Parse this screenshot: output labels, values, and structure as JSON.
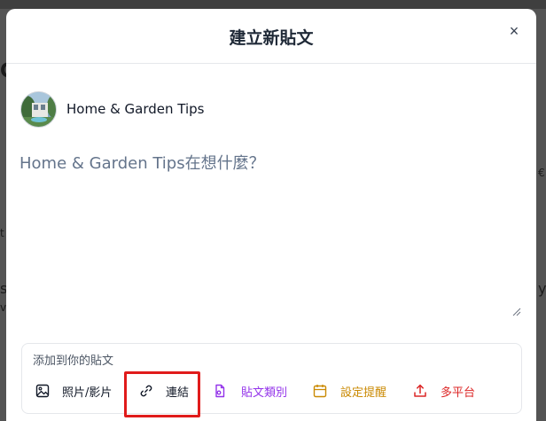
{
  "modal": {
    "title": "建立新貼文",
    "close_label": "×"
  },
  "page": {
    "name": "Home & Garden Tips"
  },
  "composer": {
    "placeholder": "Home & Garden Tips在想什麼？"
  },
  "add_to_post": {
    "title": "添加到你的貼文",
    "tools": {
      "photo": "照片/影片",
      "link": "連結",
      "post_type": "貼文類別",
      "reminder": "設定提醒",
      "multi_platform": "多平台"
    }
  },
  "background": {
    "chars": [
      "G",
      "€",
      "y",
      "t",
      "s",
      "v"
    ]
  },
  "colors": {
    "backdrop": "#545454",
    "post_type": "#9333ea",
    "reminder": "#ca8a04",
    "multi_platform": "#dc2626",
    "highlight": "#e01b1b"
  }
}
